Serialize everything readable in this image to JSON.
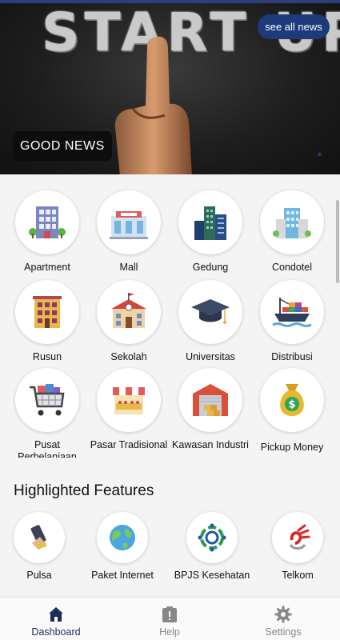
{
  "hero": {
    "headline": "START UP",
    "see_all_label": "see all news",
    "badge_label": "GOOD NEWS"
  },
  "grid": [
    {
      "label": "Apartment",
      "icon": "apartment-icon"
    },
    {
      "label": "Mall",
      "icon": "mall-icon"
    },
    {
      "label": "Gedung",
      "icon": "office-building-icon"
    },
    {
      "label": "Condotel",
      "icon": "condotel-icon"
    },
    {
      "label": "Rusun",
      "icon": "rusun-icon"
    },
    {
      "label": "Sekolah",
      "icon": "school-icon"
    },
    {
      "label": "Universitas",
      "icon": "graduation-cap-icon"
    },
    {
      "label": "Distribusi",
      "icon": "cargo-ship-icon"
    },
    {
      "label": "Pusat Perbelanjaan",
      "icon": "shopping-cart-icon"
    },
    {
      "label": "Pasar Tradisional",
      "icon": "market-stall-icon"
    },
    {
      "label": "Kawasan Industri",
      "icon": "warehouse-icon"
    },
    {
      "label": "Pickup Money",
      "icon": "money-bag-icon"
    }
  ],
  "highlighted": {
    "title": "Highlighted Features",
    "items": [
      {
        "label": "Pulsa",
        "icon": "phone-credit-icon"
      },
      {
        "label": "Paket Internet",
        "icon": "globe-icon"
      },
      {
        "label": "BPJS Kesehatan",
        "icon": "bpjs-logo-icon"
      },
      {
        "label": "Telkom",
        "icon": "telkom-logo-icon"
      }
    ]
  },
  "nav": {
    "items": [
      {
        "label": "Dashboard",
        "icon": "home-icon",
        "active": true
      },
      {
        "label": "Help",
        "icon": "help-clipboard-icon",
        "active": false
      },
      {
        "label": "Settings",
        "icon": "gear-icon",
        "active": false
      }
    ]
  },
  "colors": {
    "accent": "#1d3a7a",
    "nav_active": "#1c2c5c",
    "nav_inactive": "#888888"
  }
}
